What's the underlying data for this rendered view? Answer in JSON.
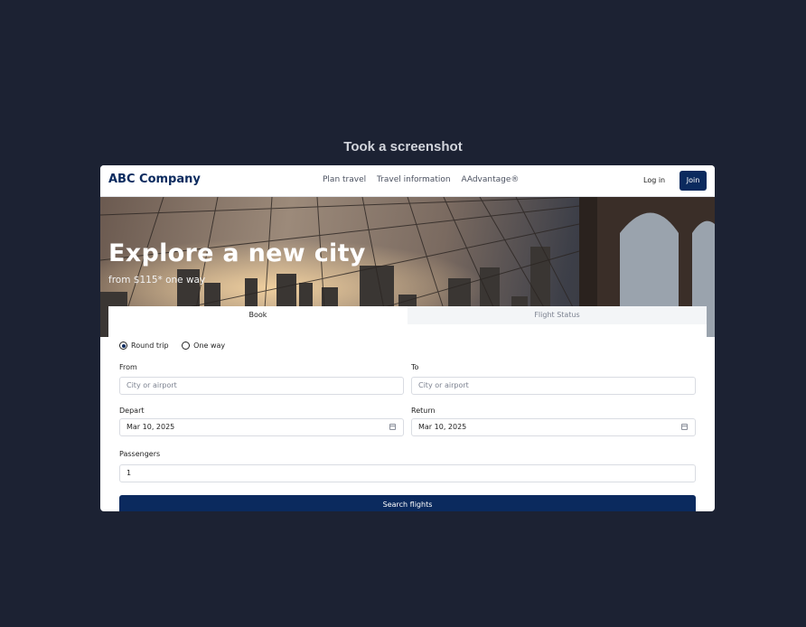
{
  "caption": "Took a screenshot",
  "nav": {
    "brand": "ABC Company",
    "links": [
      "Plan travel",
      "Travel information",
      "AAdvantage®"
    ],
    "login": "Log in",
    "join": "Join"
  },
  "hero": {
    "title": "Explore a new city",
    "subtitle": "from $115* one way"
  },
  "tabs": [
    "Book",
    "Flight Status"
  ],
  "trip": {
    "round_trip": "Round trip",
    "one_way": "One way",
    "selected": "Round trip"
  },
  "form": {
    "from_label": "From",
    "from_placeholder": "City or airport",
    "to_label": "To",
    "to_placeholder": "City or airport",
    "depart_label": "Depart",
    "depart_value": "Mar 10, 2025",
    "return_label": "Return",
    "return_value": "Mar 10, 2025",
    "passengers_label": "Passengers",
    "passengers_value": "1",
    "search_label": "Search flights"
  },
  "colors": {
    "brand": "#0b2a5e",
    "background": "#1c2233"
  }
}
